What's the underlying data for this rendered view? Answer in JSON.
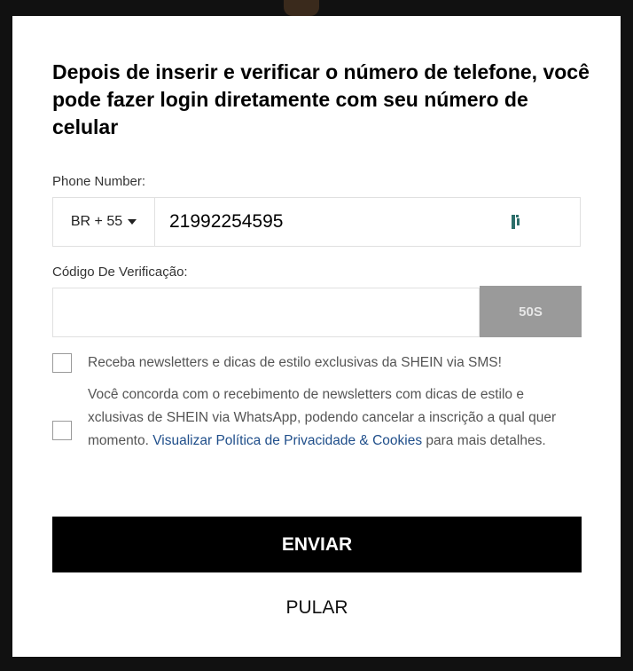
{
  "modal": {
    "title": "Depois de inserir e verificar o número de telefone, você pode fazer login diretamente com seu número de celular"
  },
  "phone": {
    "label": "Phone Number:",
    "country_code": "BR + 55",
    "value": "21992254595",
    "extension_icon": "password-manager-icon"
  },
  "verification": {
    "label": "Código De Verificação:",
    "value": "",
    "send_button": "50S"
  },
  "consents": {
    "sms_text": "Receba newsletters e dicas de estilo exclusivas da SHEIN via SMS!",
    "whatsapp_text_before": "Você concorda com o recebimento de newsletters com dicas de estilo e xclusivas de SHEIN via WhatsApp, podendo cancelar a inscrição a qual quer momento. ",
    "whatsapp_link": "Visualizar Política de Privacidade & Cookies",
    "whatsapp_text_after": " para mais detalhes."
  },
  "actions": {
    "submit": "ENVIAR",
    "skip": "PULAR"
  },
  "colors": {
    "primary": "#000000",
    "link": "#1f4e8a",
    "disabled_button": "#9a9a9a"
  }
}
